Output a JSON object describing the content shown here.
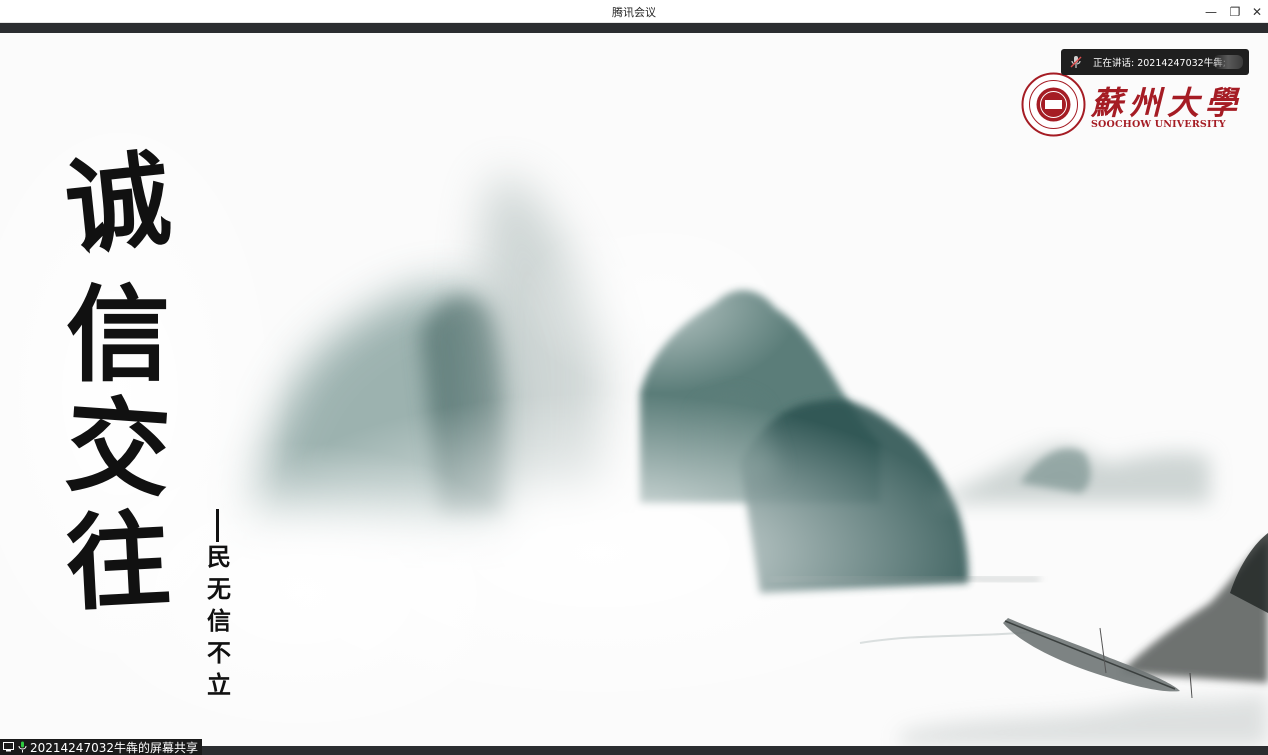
{
  "window": {
    "title": "腾讯会议",
    "minimize_glyph": "—",
    "restore_glyph": "❐",
    "close_glyph": "✕"
  },
  "speaking": {
    "label": "正在讲话: 20214247032牛犇;",
    "icon": "mic-muted-icon"
  },
  "slide": {
    "title_chars": [
      "诚",
      "信",
      "交",
      "往"
    ],
    "subtitle_chars": [
      "民",
      "无",
      "信",
      "不",
      "立"
    ],
    "logo": {
      "cn": "蘇州大學",
      "en": "SOOCHOW UNIVERSITY",
      "color": "#a51c24"
    }
  },
  "share_status": {
    "label": "20214247032牛犇的屏幕共享",
    "icons": [
      "screen-share-icon",
      "microphone-icon"
    ]
  }
}
